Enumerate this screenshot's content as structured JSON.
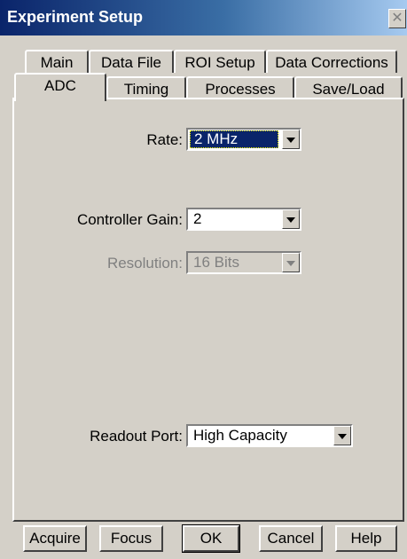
{
  "window": {
    "title": "Experiment Setup",
    "close_glyph": "✕"
  },
  "tabs_row1": [
    {
      "label": "Main"
    },
    {
      "label": "Data File"
    },
    {
      "label": "ROI Setup"
    },
    {
      "label": "Data Corrections"
    }
  ],
  "tabs_row2": [
    {
      "label": "ADC",
      "active": true
    },
    {
      "label": "Timing"
    },
    {
      "label": "Processes"
    },
    {
      "label": "Save/Load"
    }
  ],
  "fields": {
    "rate": {
      "label": "Rate:",
      "value": "2 MHz"
    },
    "controller_gain": {
      "label": "Controller Gain:",
      "value": "2"
    },
    "resolution": {
      "label": "Resolution:",
      "value": "16 Bits",
      "disabled": true
    },
    "readout_port": {
      "label": "Readout Port:",
      "value": "High Capacity"
    }
  },
  "buttons": {
    "acquire": "Acquire",
    "focus": "Focus",
    "ok": "OK",
    "cancel": "Cancel",
    "help": "Help"
  },
  "colors": {
    "titlebar_start": "#0a246a",
    "titlebar_end": "#a6caf0",
    "face": "#d4d0c8",
    "selection": "#0a246a"
  }
}
